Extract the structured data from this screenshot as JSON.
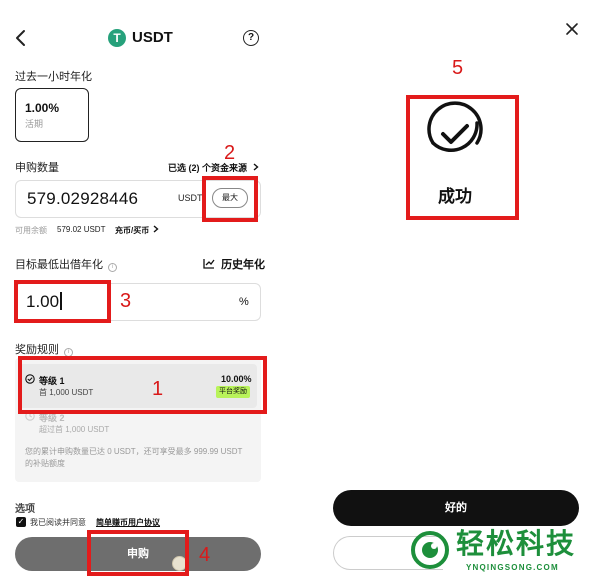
{
  "header": {
    "title": "USDT",
    "coin_glyph": "T",
    "help_glyph": "?"
  },
  "rate_section": {
    "label": "过去一小时年化",
    "value": "1.00%",
    "sub": "活期"
  },
  "amount_section": {
    "label": "申购数量",
    "selected_sources": "已选 (2) 个资金来源",
    "value": "579.02928446",
    "unit": "USDT",
    "max_label": "最大",
    "available_label": "可用余额",
    "available_value": "579.02 USDT",
    "deposit_link": "充币/买币"
  },
  "target_section": {
    "label": "目标最低出借年化",
    "info_glyph": "i",
    "history_label": "历史年化",
    "value": "1.00",
    "unit": "%"
  },
  "reward_section": {
    "label": "奖励规则",
    "info_glyph": "i",
    "tiers": [
      {
        "name": "等级 1",
        "sub": "首 1,000 USDT",
        "percent": "10.00%",
        "badge": "平台奖励"
      },
      {
        "name": "等级 2",
        "sub": "超过首 1,000 USDT"
      }
    ],
    "note": "您的累计申购数量已达 0 USDT，还可享受最多 999.99 USDT 的补贴额度"
  },
  "partial_heading": "选项",
  "agreement": {
    "prefix": "我已阅读并同意",
    "link": "简单赚币用户协议",
    "checked": true
  },
  "subscribe_label": "申购",
  "success_dialog": {
    "text": "成功",
    "ok_label": "好的"
  },
  "watermark": {
    "text": "轻松科技",
    "sub": "YNQINGSONG.COM"
  },
  "annotations": [
    "1",
    "2",
    "3",
    "4",
    "5"
  ],
  "colors": {
    "annotation_red": "#e31b1b",
    "badge_green": "#b9f35a",
    "tether_green": "#26a17b",
    "watermark_green": "#1d8f3b"
  }
}
